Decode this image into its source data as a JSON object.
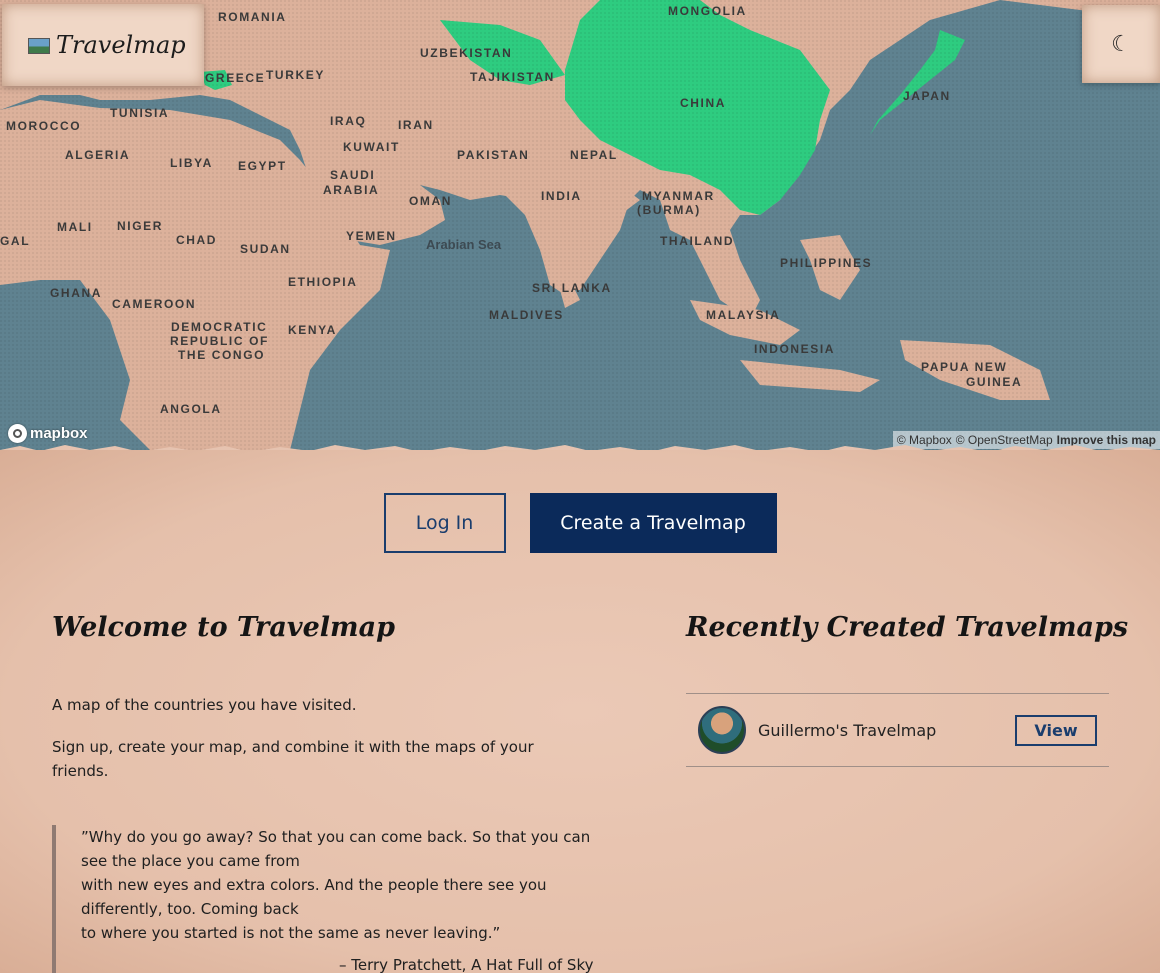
{
  "header": {
    "brand": "Travelmap",
    "flag_icon": "world-map-icon",
    "theme_toggle_icon": "moon-icon",
    "theme_toggle_glyph": "☾"
  },
  "map": {
    "highlight_color": "#2ecc80",
    "highlighted_countries": [
      "China",
      "Japan",
      "Uzbekistan",
      "Tajikistan",
      "Turkmenistan",
      "Greece"
    ],
    "labels": [
      {
        "text": "ROMANIA"
      },
      {
        "text": "MONGOLIA"
      },
      {
        "text": "UZBEKISTAN"
      },
      {
        "text": "TAJIKISTAN"
      },
      {
        "text": "GREECE"
      },
      {
        "text": "TURKEY"
      },
      {
        "text": "CHINA"
      },
      {
        "text": "JAPAN"
      },
      {
        "text": "TUNISIA"
      },
      {
        "text": "MOROCCO"
      },
      {
        "text": "IRAQ"
      },
      {
        "text": "IRAN"
      },
      {
        "text": "KUWAIT"
      },
      {
        "text": "ALGERIA"
      },
      {
        "text": "LIBYA"
      },
      {
        "text": "EGYPT"
      },
      {
        "text": "PAKISTAN"
      },
      {
        "text": "NEPAL"
      },
      {
        "text": "SAUDI"
      },
      {
        "text": "ARABIA"
      },
      {
        "text": "OMAN"
      },
      {
        "text": "INDIA"
      },
      {
        "text": "MYANMAR"
      },
      {
        "text": "(BURMA)"
      },
      {
        "text": "MALI"
      },
      {
        "text": "NIGER"
      },
      {
        "text": "CHAD"
      },
      {
        "text": "SUDAN"
      },
      {
        "text": "YEMEN"
      },
      {
        "text": "Arabian Sea"
      },
      {
        "text": "THAILAND"
      },
      {
        "text": "PHILIPPINES"
      },
      {
        "text": "GHANA"
      },
      {
        "text": "ETHIOPIA"
      },
      {
        "text": "SRI LANKA"
      },
      {
        "text": "CAMEROON"
      },
      {
        "text": "MALDIVES"
      },
      {
        "text": "MALAYSIA"
      },
      {
        "text": "DEMOCRATIC"
      },
      {
        "text": "REPUBLIC OF"
      },
      {
        "text": "THE CONGO"
      },
      {
        "text": "KENYA"
      },
      {
        "text": "INDONESIA"
      },
      {
        "text": "PAPUA NEW"
      },
      {
        "text": "GUINEA"
      },
      {
        "text": "ANGOLA"
      },
      {
        "text": "GAL"
      }
    ],
    "logo": "mapbox",
    "attribution": {
      "mapbox": "© Mapbox",
      "osm": "© OpenStreetMap",
      "improve": "Improve this map"
    }
  },
  "actions": {
    "login": "Log In",
    "create": "Create a Travelmap"
  },
  "welcome": {
    "title": "Welcome to Travelmap",
    "p1": "A map of the countries you have visited.",
    "p2": "Sign up, create your map, and combine it with the maps of your friends.",
    "quote_lines": [
      "”Why do you go away? So that you can come back. So that you can",
      "see the place you came from",
      "with new eyes and extra colors. And the people there see you",
      "differently, too. Coming back",
      "to where you started is not the same as never leaving.”"
    ],
    "citation": "– Terry Pratchett, A Hat Full of Sky"
  },
  "recent": {
    "title": "Recently Created Travelmaps",
    "items": [
      {
        "name": "Guillermo's Travelmap",
        "action": "View"
      }
    ]
  }
}
